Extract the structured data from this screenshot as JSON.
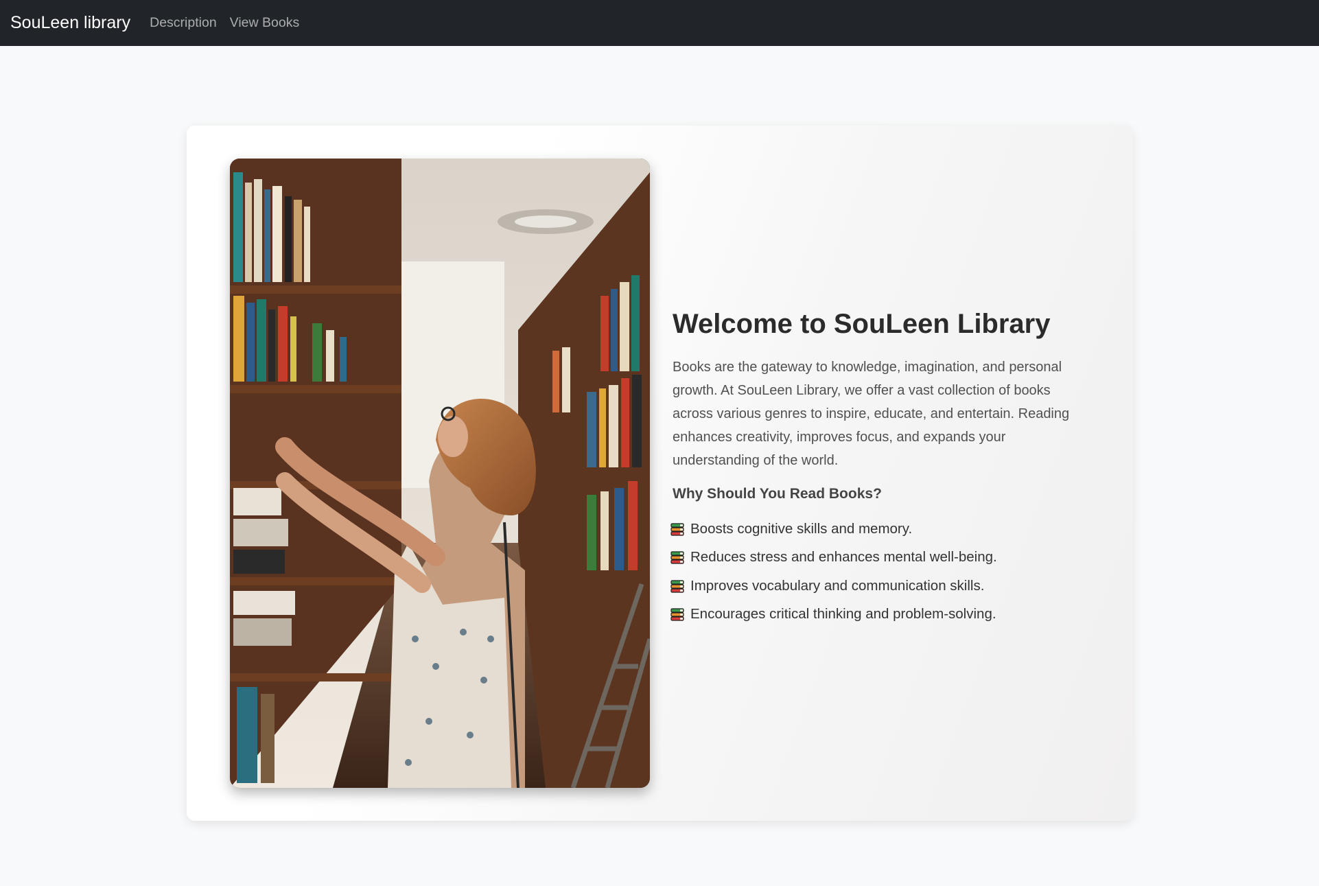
{
  "navbar": {
    "brand": "SouLeen library",
    "links": [
      "Description",
      "View Books"
    ]
  },
  "hero": {
    "image_alt": "Woman browsing books in a library aisle",
    "title": "Welcome to SouLeen Library",
    "description": "Books are the gateway to knowledge, imagination, and personal growth. At SouLeen Library, we offer a vast collection of books across various genres to inspire, educate, and entertain. Reading enhances creativity, improves focus, and expands your understanding of the world.",
    "subtitle": "Why Should You Read Books?",
    "benefits": [
      {
        "icon": "books-icon",
        "text": "Boosts cognitive skills and memory."
      },
      {
        "icon": "books-icon",
        "text": "Reduces stress and enhances mental well-being."
      },
      {
        "icon": "books-icon",
        "text": "Improves vocabulary and communication skills."
      },
      {
        "icon": "books-icon",
        "text": "Encourages critical thinking and problem-solving."
      }
    ]
  },
  "colors": {
    "navbar_bg": "#212529",
    "page_bg": "#f8f9fa",
    "brand_text": "#ffffff"
  }
}
